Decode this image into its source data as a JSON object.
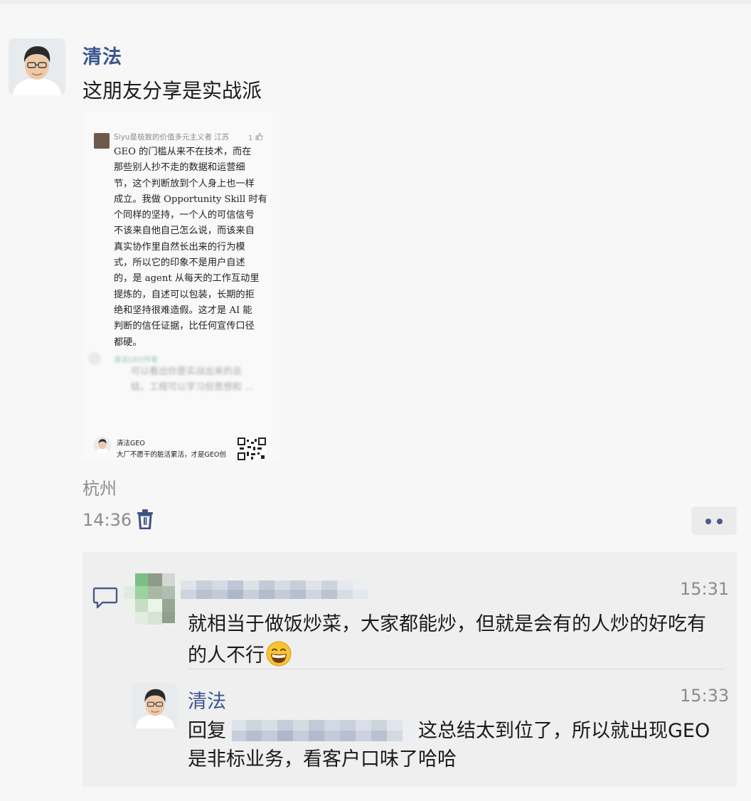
{
  "post": {
    "author": "清法",
    "text": "这朋友分享是实战派",
    "location": "杭州",
    "time": "14:36"
  },
  "shared_image": {
    "user": "Siyu是极致的价值多元主义者 江苏",
    "like_count": "1",
    "comment_lines": [
      "GEO 的门槛从来不在技术，而在",
      "那些别人抄不走的数据和运营细",
      "节，这个判断放到个人身上也一样",
      "成立。我做 Opportunity Skill 时有",
      "个同样的坚持，一个人的可信信号",
      "不该来自他自己怎么说，而该来自",
      "真实协作里自然长出来的行为模",
      "式，所以它的印象不是用户自述",
      "的，是 agent 从每天的工作互动里",
      "提炼的，自述可以包装，长期的拒",
      "绝和坚持很难造假。这才是 AI 能",
      "判断的信任证据，比任何宣传口径",
      "都硬。"
    ],
    "blurred_reply_name": "清法GEO作者",
    "blurred_reply_lines": [
      "可以看出你是实战出来的总",
      "结，工程可以学习但思想和 ..."
    ],
    "footer_name": "清法GEO",
    "footer_slogan": "大厂不愿干的脏活累活，才是GEO创"
  },
  "comments": [
    {
      "time": "15:31",
      "lines": [
        "就相当于做饭炒菜，大家都能炒，但就是会有的人炒的好吃有",
        "的人不行"
      ],
      "emoji": "grinning-face-emoji"
    },
    {
      "author": "清法",
      "time": "15:33",
      "prefix": "回复",
      "suffix": "这总结太到位了，所以就出现GEO",
      "line2": "是非标业务，看客户口味了哈哈"
    }
  ],
  "icons": {
    "trash": "trash-icon",
    "more": "more-dots-icon",
    "comment": "comment-bubble-icon"
  },
  "colors": {
    "name_blue": "#3a5590",
    "meta_gray": "#8b8b8b",
    "panel_bg": "#efefef"
  }
}
